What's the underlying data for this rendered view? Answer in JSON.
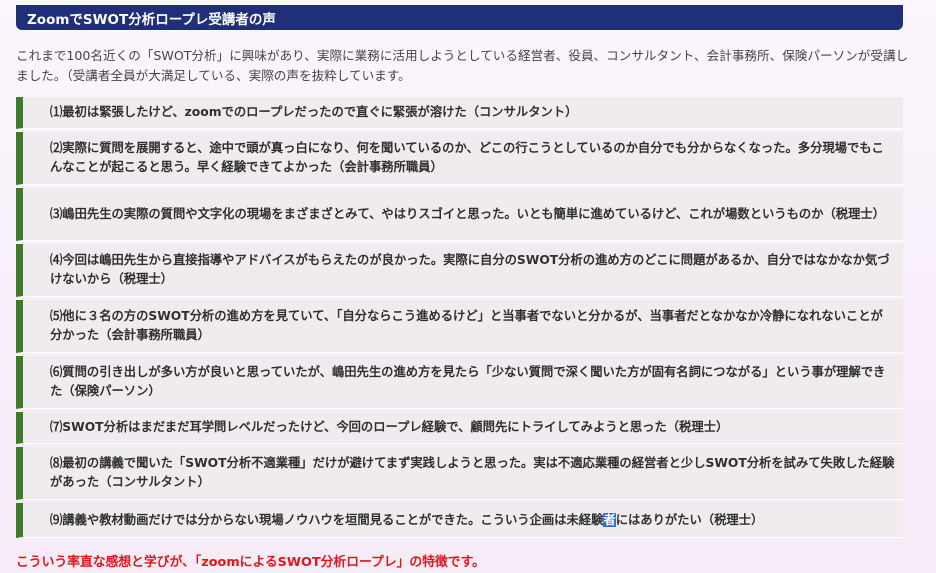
{
  "header": {
    "title": "ZoomでSWOT分析ロープレ受講者の声"
  },
  "intro": {
    "text": "これまで100名近くの「SWOT分析」に興味があり、実際に業務に活用しようとしている経営者、役員、コンサルタント、会計事務所、保険パーソンが受講しました。（受講者全員が大満足している、実際の声を抜粋しています。"
  },
  "reviews": [
    {
      "text": "⑴最初は緊張したけど、zoomでのロープレだったので直ぐに緊張が溶けた（コンサルタント）"
    },
    {
      "text": "⑵実際に質問を展開すると、途中で頭が真っ白になり、何を聞いているのか、どこの行こうとしているのか自分でも分からなくなった。多分現場でもこんなことが起こると思う。早く経験できてよかった（会計事務所職員）"
    },
    {
      "text": "⑶嶋田先生の実際の質問や文字化の現場をまざまざとみて、やはりスゴイと思った。いとも簡単に進めているけど、これが場数というものか（税理士）"
    },
    {
      "text": "⑷今回は嶋田先生から直接指導やアドバイスがもらえたのが良かった。実際に自分のSWOT分析の進め方のどこに問題があるか、自分ではなかなか気づけないから（税理士）"
    },
    {
      "text": "⑸他に３名の方のSWOT分析の進め方を見ていて、「自分ならこう進めるけど」と当事者でないと分かるが、当事者だとなかなか冷静になれないことが分かった（会計事務所職員）"
    },
    {
      "text": "⑹質問の引き出しが多い方が良いと思っていたが、嶋田先生の進め方を見たら「少ない質問で深く聞いた方が固有名詞につながる」という事が理解できた（保険パーソン）"
    },
    {
      "text": "⑺SWOT分析はまだまだ耳学問レベルだったけど、今回のロープレ経験で、顧問先にトライしてみようと思った（税理士）"
    },
    {
      "text": "⑻最初の講義で聞いた「SWOT分析不適業種」だけが避けてまず実践しようと思った。実は不適応業種の経営者と少しSWOT分析を試みて失敗した経験があった（コンサルタント）"
    },
    {
      "text_before": "⑼講義や教材動画だけでは分からない現場ノウハウを垣間見ることができた。こういう企画は未経験",
      "text_selected": "者",
      "text_after": "にはありがたい（税理士）"
    }
  ],
  "closing": {
    "text": "こういう率直な感想と学びが、「zoomによるSWOT分析ロープレ」の特徴です。"
  },
  "colors": {
    "header_bg": "#1f2f78",
    "accent_border": "#3e7a2b",
    "item_bg": "#efebee",
    "closing_text": "#e0161b",
    "selection": "#2f6fd6"
  }
}
